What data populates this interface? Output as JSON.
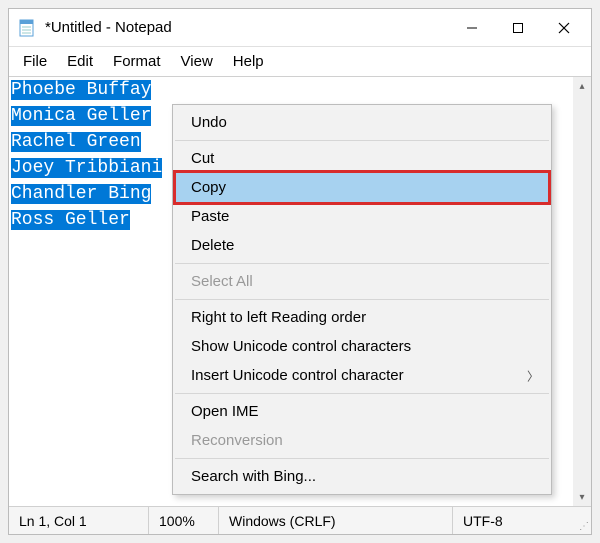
{
  "window": {
    "title": "*Untitled - Notepad"
  },
  "menu": {
    "file": "File",
    "edit": "Edit",
    "format": "Format",
    "view": "View",
    "help": "Help"
  },
  "text_lines": [
    "Phoebe Buffay",
    "Monica Geller",
    "Rachel Green",
    "Joey Tribbiani",
    "Chandler Bing",
    "Ross Geller"
  ],
  "context_menu": {
    "undo": "Undo",
    "cut": "Cut",
    "copy": "Copy",
    "paste": "Paste",
    "delete": "Delete",
    "select_all": "Select All",
    "rtl": "Right to left Reading order",
    "show_unicode": "Show Unicode control characters",
    "insert_unicode": "Insert Unicode control character",
    "open_ime": "Open IME",
    "reconversion": "Reconversion",
    "search_bing": "Search with Bing..."
  },
  "status": {
    "position": "Ln 1, Col 1",
    "zoom": "100%",
    "line_ending": "Windows (CRLF)",
    "encoding": "UTF-8"
  }
}
